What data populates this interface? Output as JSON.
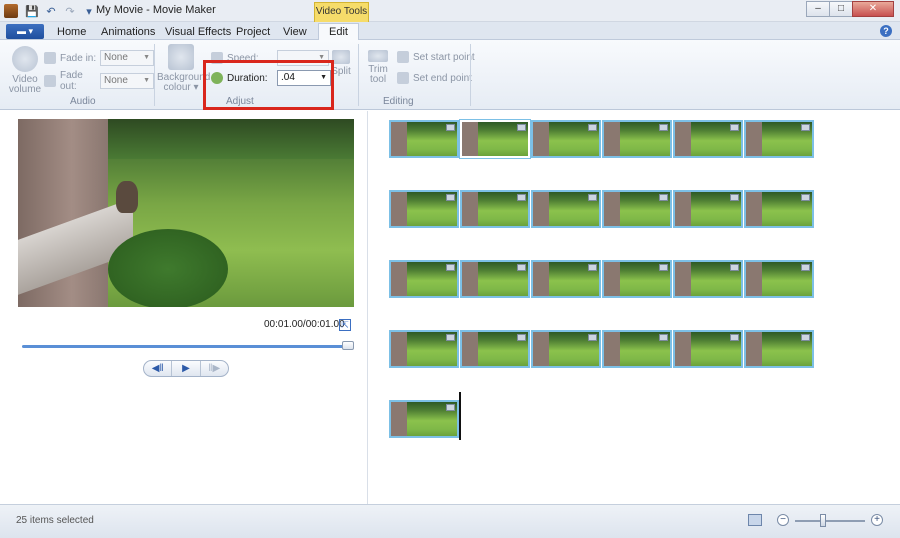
{
  "window": {
    "title": "My Movie - Movie Maker",
    "context_tab": "Video Tools",
    "controls": {
      "minimize": "‒",
      "maximize": "□",
      "close": "✕"
    }
  },
  "quick_access": {
    "save": "💾",
    "undo": "↶",
    "redo": "↷",
    "customize": "▾"
  },
  "ribbon": {
    "file_button": "▬ ▾",
    "tabs": [
      "Home",
      "Animations",
      "Visual Effects",
      "Project",
      "View",
      "Edit"
    ],
    "active_tab": "Edit",
    "help": "?",
    "audio": {
      "video_volume": [
        "Video",
        "volume"
      ],
      "fade_in_label": "Fade in:",
      "fade_in_value": "None",
      "fade_out_label": "Fade out:",
      "fade_out_value": "None",
      "group_label": "Audio"
    },
    "adjust": {
      "background_colour": [
        "Background",
        "colour ▾"
      ],
      "speed_label": "Speed:",
      "speed_value": "",
      "duration_label": "Duration:",
      "duration_value": ".04",
      "group_label": "Adjust"
    },
    "editing": {
      "split_label": "Split",
      "trim_tool": [
        "Trim",
        "tool"
      ],
      "set_start_point": "Set start point",
      "set_end_point": "Set end point",
      "group_label": "Editing"
    }
  },
  "preview": {
    "timecode": "00:01.00/00:01.00",
    "expand_icon": "⇱",
    "transport": {
      "previous_frame": "◀‖",
      "play": "▶",
      "next_frame": "‖▶"
    }
  },
  "storyboard": {
    "clip_count": 25,
    "selected_index": 1,
    "columns": 6
  },
  "status": {
    "text": "25 items selected",
    "zoom_out": "−",
    "zoom_in": "+"
  }
}
